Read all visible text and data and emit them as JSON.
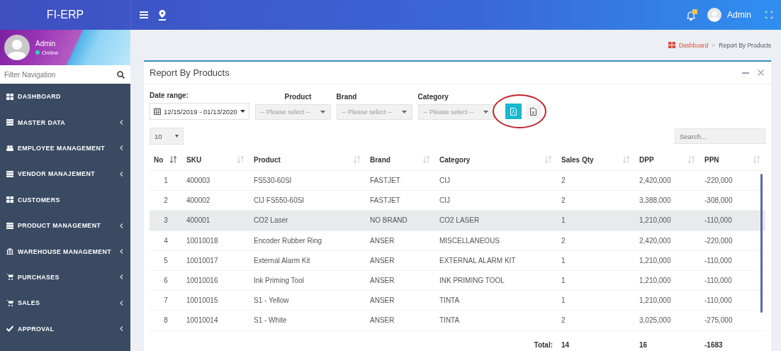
{
  "app": {
    "brand": "FI-ERP",
    "user": "Admin"
  },
  "sidebar": {
    "user": "Admin",
    "status": "Online",
    "filter_placeholder": "Filter Navigation",
    "items": [
      {
        "label": "DASHBOARD",
        "expandable": false
      },
      {
        "label": "MASTER DATA",
        "expandable": true
      },
      {
        "label": "EMPLOYEE MANAGEMENT",
        "expandable": true
      },
      {
        "label": "VENDOR MANAJEMENT",
        "expandable": true
      },
      {
        "label": "CUSTOMERS",
        "expandable": false
      },
      {
        "label": "PRODUCT MANAGEMENT",
        "expandable": true
      },
      {
        "label": "WAREHOUSE MANAGEMENT",
        "expandable": true
      },
      {
        "label": "PURCHASES",
        "expandable": true
      },
      {
        "label": "SALES",
        "expandable": true
      },
      {
        "label": "APPROVAL",
        "expandable": true
      }
    ]
  },
  "breadcrumb": {
    "items": [
      "Dashboard",
      "Report By Products"
    ],
    "separator": ">"
  },
  "report": {
    "title": "Report By Products",
    "filters": [
      {
        "label": "Date range:",
        "value": "12/15/2019 - 01/13/2020",
        "kind": "date"
      },
      {
        "label": "Product",
        "placeholder": "-- Please select --",
        "kind": "select"
      },
      {
        "label": "Brand",
        "placeholder": "-- Please select --",
        "kind": "select"
      },
      {
        "label": "Category",
        "placeholder": "-- Please select --",
        "kind": "select"
      }
    ],
    "page_length": "10",
    "search_placeholder": "Search...",
    "table": {
      "columns": [
        {
          "label": "No",
          "sorted": true
        },
        {
          "label": "SKU",
          "sorted": false
        },
        {
          "label": "Product",
          "sorted": false
        },
        {
          "label": "Brand",
          "sorted": false
        },
        {
          "label": "Category",
          "sorted": false
        },
        {
          "label": "Sales Qty",
          "sorted": false
        },
        {
          "label": "DPP",
          "sorted": false
        },
        {
          "label": "PPN",
          "sorted": false
        }
      ],
      "rows": [
        {
          "cells": [
            "1",
            "400003",
            "FS530-60SI",
            "FASTJET",
            "CIJ",
            "2",
            "2,420,000",
            "-220,000"
          ],
          "highlighted": false
        },
        {
          "cells": [
            "2",
            "400002",
            "CIJ FS550-60SI",
            "FASTJET",
            "CIJ",
            "2",
            "3,388,000",
            "-308,000"
          ],
          "highlighted": false
        },
        {
          "cells": [
            "3",
            "400001",
            "CO2 Laser",
            "NO BRAND",
            "CO2 LASER",
            "1",
            "1,210,000",
            "-110,000"
          ],
          "highlighted": true
        },
        {
          "cells": [
            "4",
            "10010018",
            "Encoder Rubber Ring",
            "ANSER",
            "MISCELLANEOUS",
            "2",
            "2,420,000",
            "-220,000"
          ],
          "highlighted": false
        },
        {
          "cells": [
            "5",
            "10010017",
            "External Alarm Kit",
            "ANSER",
            "EXTERNAL ALARM KIT",
            "1",
            "1,210,000",
            "-110,000"
          ],
          "highlighted": false
        },
        {
          "cells": [
            "6",
            "10010016",
            "Ink Priming Tool",
            "ANSER",
            "INK PRIMING TOOL",
            "1",
            "1,210,000",
            "-110,000"
          ],
          "highlighted": false
        },
        {
          "cells": [
            "7",
            "10010015",
            "S1 - Yellow",
            "ANSER",
            "TINTA",
            "1",
            "1,210,000",
            "-110,000"
          ],
          "highlighted": false
        },
        {
          "cells": [
            "8",
            "10010014",
            "S1 - White",
            "ANSER",
            "TINTA",
            "2",
            "3,025,000",
            "-275,000"
          ],
          "highlighted": false
        }
      ],
      "footer": [
        "Total:",
        "14",
        "16",
        "-1683"
      ]
    }
  }
}
